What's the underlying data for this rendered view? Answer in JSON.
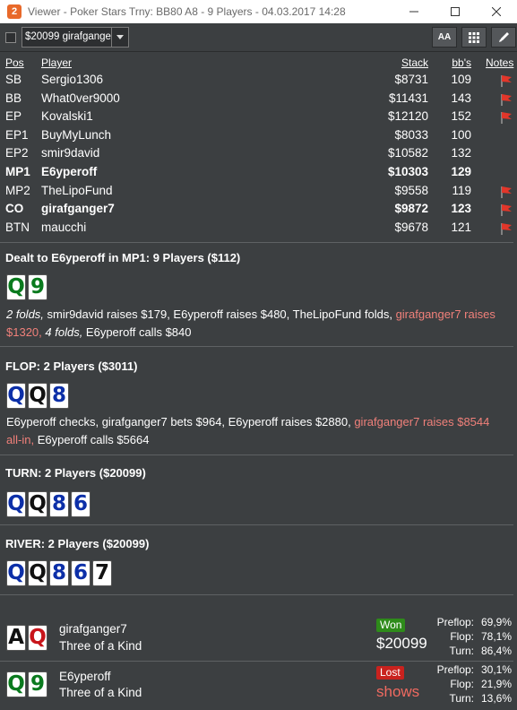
{
  "window": {
    "app_icon_letter": "2",
    "title": "Viewer - Poker Stars Trny: BB80 A8 - 9 Players - 04.03.2017 14:28"
  },
  "toolbar": {
    "hand_selector_value": "$20099 girafganger",
    "font_button_label": "AA"
  },
  "table": {
    "headers": {
      "pos": "Pos",
      "player": "Player",
      "stack": "Stack",
      "bbs": "bb's",
      "notes": "Notes"
    },
    "rows": [
      {
        "pos": "SB",
        "player": "Sergio1306",
        "stack": "$8731",
        "bbs": "109",
        "flag": true,
        "bold": false
      },
      {
        "pos": "BB",
        "player": "What0ver9000",
        "stack": "$11431",
        "bbs": "143",
        "flag": true,
        "bold": false
      },
      {
        "pos": "EP",
        "player": "Kovalski1",
        "stack": "$12120",
        "bbs": "152",
        "flag": true,
        "bold": false
      },
      {
        "pos": "EP1",
        "player": "BuyMyLunch",
        "stack": "$8033",
        "bbs": "100",
        "flag": false,
        "bold": false
      },
      {
        "pos": "EP2",
        "player": "smir9david",
        "stack": "$10582",
        "bbs": "132",
        "flag": false,
        "bold": false
      },
      {
        "pos": "MP1",
        "player": "E6yperoff",
        "stack": "$10303",
        "bbs": "129",
        "flag": false,
        "bold": true
      },
      {
        "pos": "MP2",
        "player": "TheLipoFund",
        "stack": "$9558",
        "bbs": "119",
        "flag": true,
        "bold": false
      },
      {
        "pos": "CO",
        "player": "girafganger7",
        "stack": "$9872",
        "bbs": "123",
        "flag": true,
        "bold": true
      },
      {
        "pos": "BTN",
        "player": "maucchi",
        "stack": "$9678",
        "bbs": "121",
        "flag": true,
        "bold": false
      }
    ]
  },
  "preflop": {
    "title": "Dealt to E6yperoff in MP1: 9 Players ($112)",
    "cards": [
      {
        "rank": "Q",
        "color": "green"
      },
      {
        "rank": "9",
        "color": "green"
      }
    ],
    "action": {
      "p1": "2 folds,",
      "p2": " smir9david raises $179, E6yperoff raises $480, TheLipoFund folds, ",
      "p3": "girafganger7 raises $1320,",
      "p4": " ",
      "p5": "4 folds,",
      "p6": " E6yperoff calls $840"
    }
  },
  "flop": {
    "title": "FLOP: 2 Players ($3011)",
    "cards": [
      {
        "rank": "Q",
        "color": "blue"
      },
      {
        "rank": "Q",
        "color": "black"
      },
      {
        "rank": "8",
        "color": "blue"
      }
    ],
    "action": {
      "p1": "E6yperoff checks, girafganger7 bets $964, E6yperoff raises $2880, ",
      "p2": "girafganger7 raises $8544 all-in,",
      "p3": " E6yperoff calls $5664"
    }
  },
  "turn": {
    "title": "TURN: 2 Players ($20099)",
    "cards": [
      {
        "rank": "Q",
        "color": "blue"
      },
      {
        "rank": "Q",
        "color": "black"
      },
      {
        "rank": "8",
        "color": "blue"
      },
      {
        "rank": "6",
        "color": "blue"
      }
    ]
  },
  "river": {
    "title": "RIVER: 2 Players ($20099)",
    "cards": [
      {
        "rank": "Q",
        "color": "blue"
      },
      {
        "rank": "Q",
        "color": "black"
      },
      {
        "rank": "8",
        "color": "blue"
      },
      {
        "rank": "6",
        "color": "blue"
      },
      {
        "rank": "7",
        "color": "black"
      }
    ]
  },
  "showdown": [
    {
      "player": "girafganger7",
      "hand": "Three of a Kind",
      "cards": [
        {
          "rank": "A",
          "color": "black"
        },
        {
          "rank": "Q",
          "color": "red"
        }
      ],
      "result": "Won",
      "amount": "$20099",
      "stats": [
        {
          "label": "Preflop:",
          "value": "69,9%"
        },
        {
          "label": "Flop:",
          "value": "78,1%"
        },
        {
          "label": "Turn:",
          "value": "86,4%"
        }
      ]
    },
    {
      "player": "E6yperoff",
      "hand": "Three of a Kind",
      "cards": [
        {
          "rank": "Q",
          "color": "green"
        },
        {
          "rank": "9",
          "color": "green"
        }
      ],
      "result": "Lost",
      "amount": "shows",
      "stats": [
        {
          "label": "Preflop:",
          "value": "30,1%"
        },
        {
          "label": "Flop:",
          "value": "21,9%"
        },
        {
          "label": "Turn:",
          "value": "13,6%"
        }
      ]
    }
  ]
}
